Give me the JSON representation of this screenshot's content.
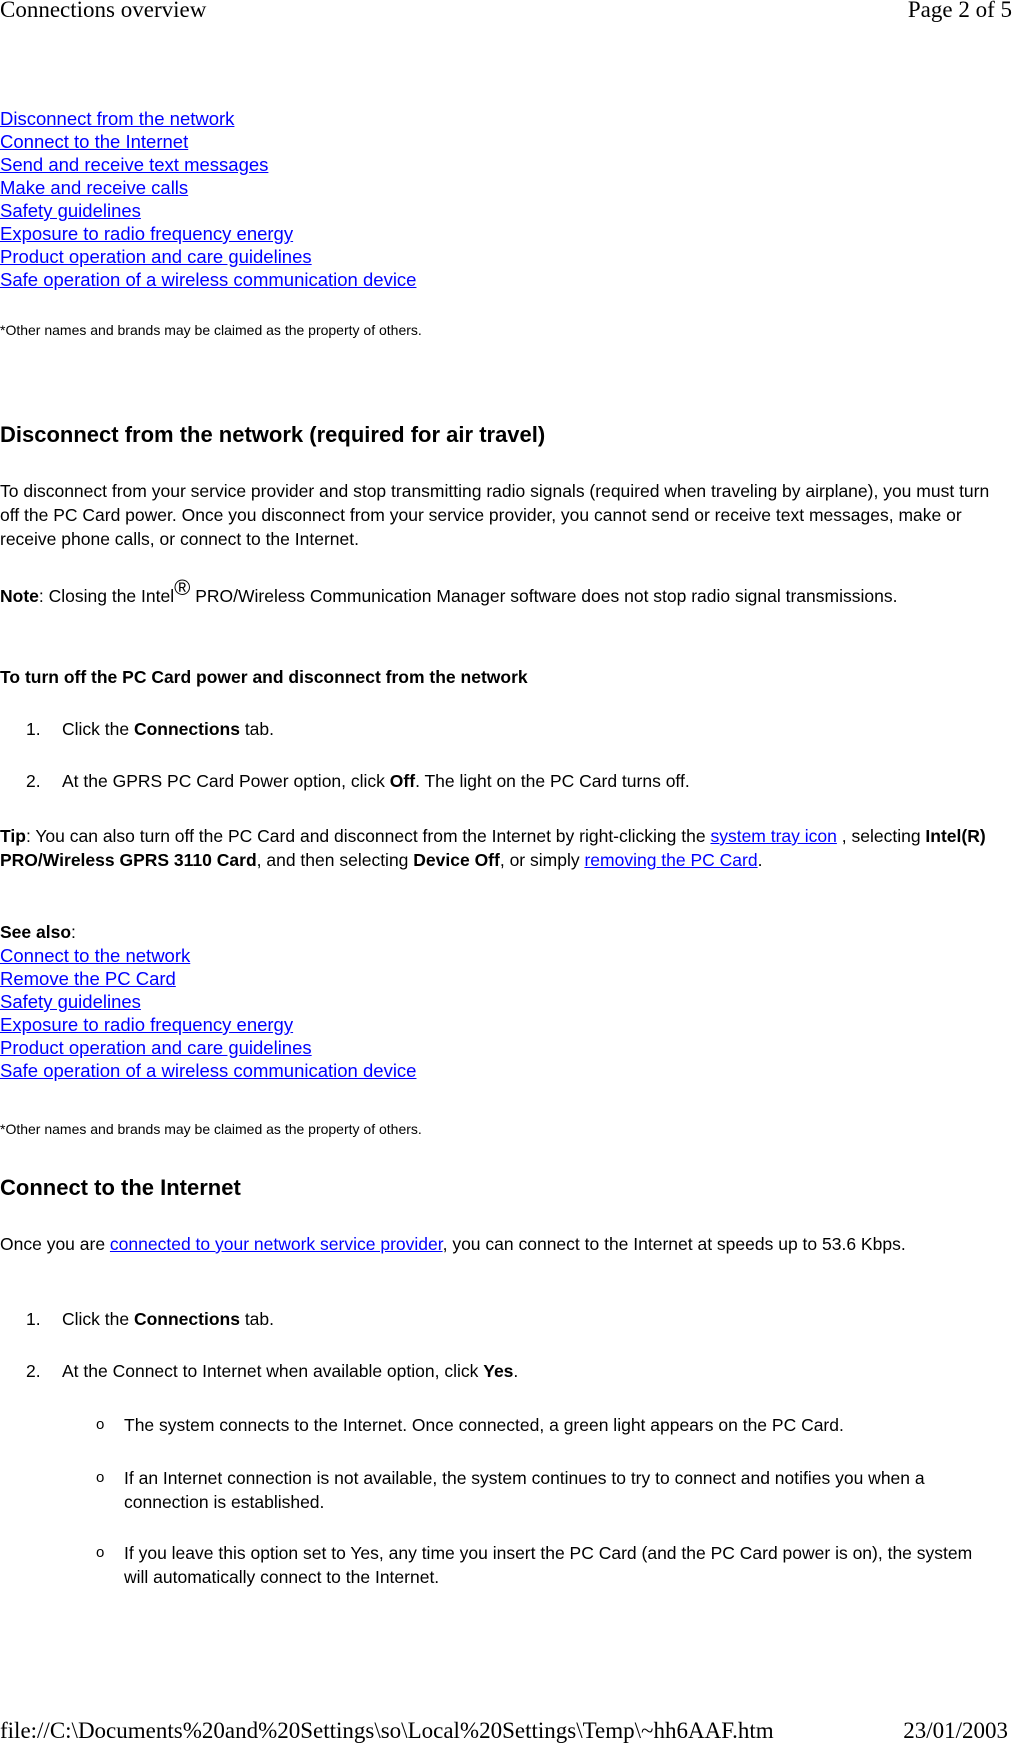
{
  "header": {
    "title": "Connections overview",
    "page_indicator": "Page 2 of 5"
  },
  "toc_links": [
    "Disconnect from the network",
    "Connect to the Internet",
    "Send and receive text messages",
    "Make and receive calls",
    "Safety guidelines",
    "Exposure to radio frequency energy",
    "Product operation and care guidelines",
    "Safe operation of a wireless communication device"
  ],
  "trademark_note": "*Other names and brands may be claimed as the property of others.",
  "section_disconnect": {
    "heading": "Disconnect from the network (required for air travel)",
    "intro": "To disconnect from your service provider and stop transmitting radio signals (required when traveling by airplane), you must turn off the PC Card power. Once you disconnect from your service provider, you cannot send or receive text messages, make or receive phone calls, or connect to the Internet.",
    "note_label": "Note",
    "note_text_before": ": Closing the Intel",
    "note_sup": "®",
    "note_text_after": " PRO/Wireless Communication Manager software does not stop radio signal transmissions.",
    "procedure_title": "To turn off the PC Card power and disconnect from the network",
    "steps": [
      {
        "num": "1.",
        "before": "Click the ",
        "bold": "Connections",
        "after": " tab."
      },
      {
        "num": "2.",
        "before": "At the GPRS PC Card Power option, click ",
        "bold": "Off",
        "after": ". The light on the PC Card turns off."
      }
    ],
    "tip": {
      "label": "Tip",
      "t1": ": You can also turn off the PC Card and disconnect from the Internet by right-clicking the ",
      "link1": "system tray icon",
      "t2": " , selecting ",
      "bold1": "Intel(R) PRO/Wireless GPRS 3110 Card",
      "t3": ", and then selecting ",
      "bold2": "Device Off",
      "t4": ", or simply ",
      "link2": "removing the PC Card",
      "t5": "."
    },
    "see_also_label": "See also",
    "see_also_colon": ":",
    "see_also_links": [
      "Connect to the network",
      "Remove the PC Card",
      "Safety guidelines",
      "Exposure to radio frequency energy",
      "Product operation and care guidelines",
      "Safe operation of a wireless communication device"
    ]
  },
  "section_internet": {
    "heading": "Connect to the Internet",
    "intro_before": "Once you are ",
    "intro_link": "connected to your network service provider",
    "intro_after": ", you can connect to the Internet at speeds up to 53.6 Kbps.",
    "steps": [
      {
        "num": "1.",
        "before": "Click the ",
        "bold": "Connections",
        "after": " tab."
      },
      {
        "num": "2.",
        "before": "At the Connect to Internet when available option, click ",
        "bold": "Yes",
        "after": "."
      }
    ],
    "bullets": [
      "The system connects to the Internet. Once connected, a green light appears on the PC Card.",
      "If an Internet connection is not available, the system continues to try to connect and notifies you when a connection is established.",
      "If you leave this option set to Yes, any time you insert the PC Card (and the PC Card power is on), the system will automatically connect to the Internet."
    ],
    "bullet_glyph": "o"
  },
  "footer": {
    "path": "file://C:\\Documents%20and%20Settings\\so\\Local%20Settings\\Temp\\~hh6AAF.htm",
    "date": "23/01/2003"
  }
}
